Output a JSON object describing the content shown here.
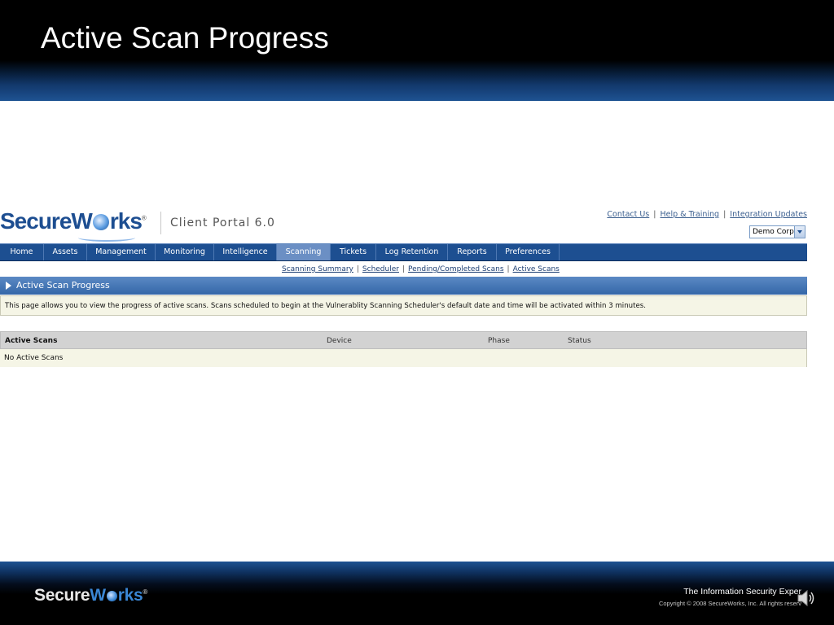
{
  "slide": {
    "title": "Active Scan Progress",
    "footer_logo_secure": "Secure",
    "footer_logo_w": "W",
    "footer_logo_rks": "rks",
    "footer_logo_mark": "®",
    "tagline": "The Information Security Exper",
    "copyright": "Copyright © 2008 SecureWorks, Inc. All rights reserv"
  },
  "portal": {
    "logo_secure": "Secure",
    "logo_w": "W",
    "logo_rks": "rks",
    "logo_mark": "®",
    "client_portal": "Client Portal 6.0",
    "toplinks": [
      "Contact Us",
      "Help & Training",
      "Integration Updates"
    ],
    "company": "Demo Corp",
    "nav": [
      "Home",
      "Assets",
      "Management",
      "Monitoring",
      "Intelligence",
      "Scanning",
      "Tickets",
      "Log Retention",
      "Reports",
      "Preferences"
    ],
    "active_nav": "Scanning",
    "subnav": [
      "Scanning Summary",
      "Scheduler",
      "Pending/Completed Scans",
      "Active Scans"
    ],
    "section_title": "Active Scan Progress",
    "info_text": "This page allows you to view the progress of active scans. Scans scheduled to begin at the Vulnerablity Scanning Scheduler's default date and time will be activated within 3 minutes.",
    "table": {
      "columns": [
        "Active Scans",
        "Device",
        "Phase",
        "Status"
      ],
      "empty_message": "No Active Scans"
    }
  },
  "colors": {
    "nav_bg": "#1d4f91",
    "nav_active": "#6b8fc4",
    "section_header": "#3467a8",
    "info_bg": "#f5f5e6"
  }
}
